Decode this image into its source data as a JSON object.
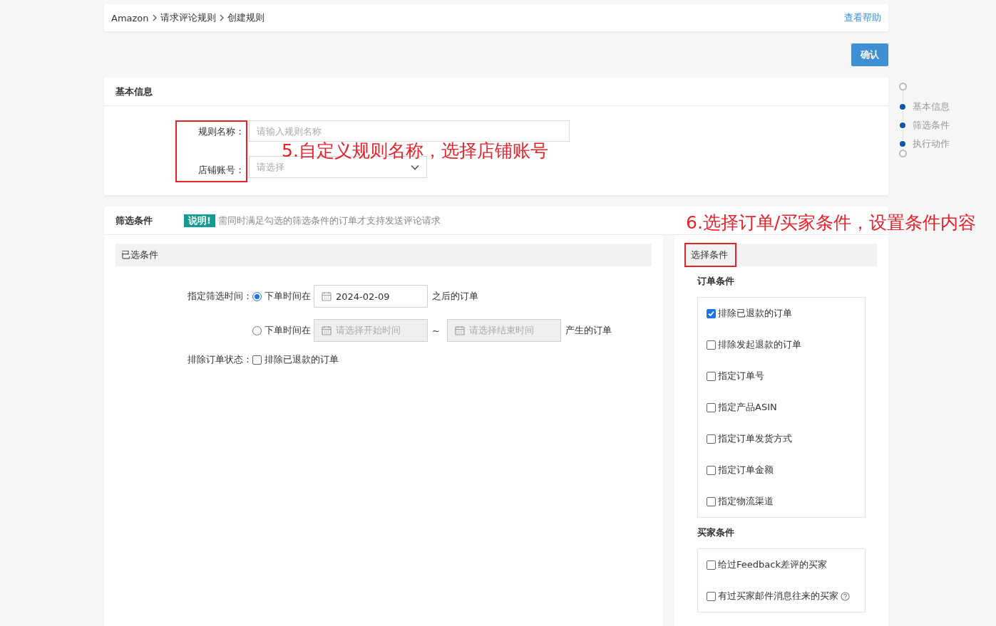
{
  "breadcrumb": {
    "items": [
      "Amazon",
      "请求评论规则",
      "创建规则"
    ],
    "help_link": "查看帮助"
  },
  "confirm_button": "确认",
  "steps": [
    {
      "label": "基本信息"
    },
    {
      "label": "筛选条件"
    },
    {
      "label": "执行动作"
    }
  ],
  "basic_info": {
    "title": "基本信息",
    "fields": [
      {
        "kind": "text",
        "label": "规则名称：",
        "placeholder": "请输入规则名称"
      },
      {
        "kind": "select",
        "label": "店铺账号：",
        "placeholder": "请选择"
      }
    ],
    "annotation": "5.自定义规则名称，选择店铺账号"
  },
  "filter": {
    "title": "筛选条件",
    "note_badge": "说明!",
    "note": "需同时满足勾选的筛选条件的订单才支持发送评论请求",
    "annotation": "6.选择订单/买家条件，设置条件内容",
    "selected_panel": {
      "title": "已选条件",
      "time_label": "指定筛选时间：",
      "time_options": [
        {
          "selected": true,
          "prefix": "下单时间在",
          "dates": [
            {
              "value": "2024-02-09",
              "disabled": false
            }
          ],
          "suffix": "之后的订单"
        },
        {
          "selected": false,
          "prefix": "下单时间在",
          "dates": [
            {
              "placeholder": "请选择开始时间",
              "disabled": true
            },
            {
              "placeholder": "请选择结束时间",
              "disabled": true
            }
          ],
          "separator": "~",
          "suffix": "产生的订单"
        }
      ],
      "status_label": "排除订单状态：",
      "status_options": [
        {
          "label": "排除已退款的订单",
          "checked": false
        }
      ]
    },
    "choose_panel": {
      "title": "选择条件",
      "groups": [
        {
          "title": "订单条件",
          "options": [
            {
              "label": "排除已退款的订单",
              "checked": true
            },
            {
              "label": "排除发起退款的订单",
              "checked": false
            },
            {
              "label": "指定订单号",
              "checked": false
            },
            {
              "label": "指定产品ASIN",
              "checked": false
            },
            {
              "label": "指定订单发货方式",
              "checked": false
            },
            {
              "label": "指定订单金额",
              "checked": false
            },
            {
              "label": "指定物流渠道",
              "checked": false
            }
          ]
        },
        {
          "title": "买家条件",
          "options": [
            {
              "label": "给过Feedback差评的买家",
              "checked": false
            },
            {
              "label": "有过买家邮件消息往来的买家",
              "checked": false,
              "help": true
            }
          ]
        }
      ]
    }
  }
}
